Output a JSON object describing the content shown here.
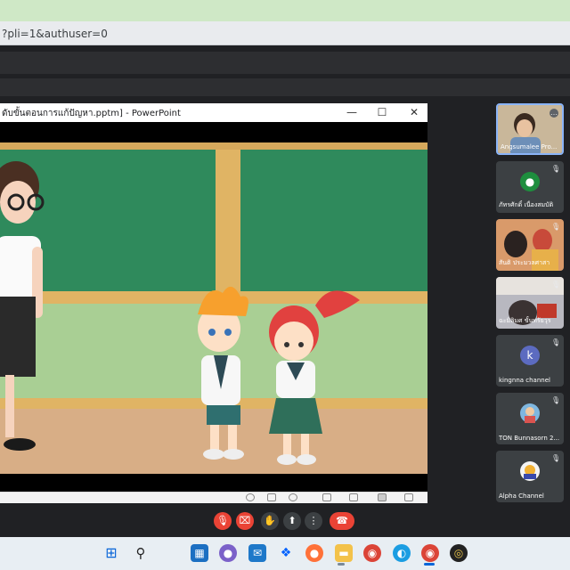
{
  "browser": {
    "url_fragment": "?pli=1&authuser=0"
  },
  "presentation": {
    "window_title": "ดับขั้นตอนการแก้ปัญหา.pptm] - PowerPoint",
    "minimize_glyph": "—",
    "maximize_glyph": "☐",
    "close_glyph": "✕"
  },
  "participants": [
    {
      "name": "Angsumalee Pro...",
      "kind": "video"
    },
    {
      "name": "ภัทรศักดิ์ เนื่องสมบัติ",
      "kind": "avatar",
      "avatar_color": "#1e8e3e"
    },
    {
      "name": "สันติ ประมวลศาสา",
      "kind": "video"
    },
    {
      "name": "ฉะมิลิมศ ขั้นทรัยวุร",
      "kind": "video"
    },
    {
      "name": "kingnna channel",
      "kind": "letter",
      "letter": "k",
      "avatar_color": "#5c6bc0"
    },
    {
      "name": "TON Bunnasorn 2...",
      "kind": "photo"
    },
    {
      "name": "Alpha Channel",
      "kind": "photo"
    }
  ],
  "controls": {
    "mic_glyph": "🎙",
    "cam_glyph": "⌧",
    "hand_glyph": "✋",
    "present_glyph": "⬆",
    "more_glyph": "⋮",
    "leave_glyph": "☎",
    "danger_color": "#ea4335"
  },
  "taskbar": {
    "icons": [
      "windows-icon",
      "search-icon",
      "widgets-icon",
      "chat-icon",
      "mail-icon",
      "dropbox-icon",
      "firefox-icon",
      "folder-icon",
      "chrome-icon",
      "edge-icon",
      "chrome-icon",
      "app-icon"
    ]
  }
}
